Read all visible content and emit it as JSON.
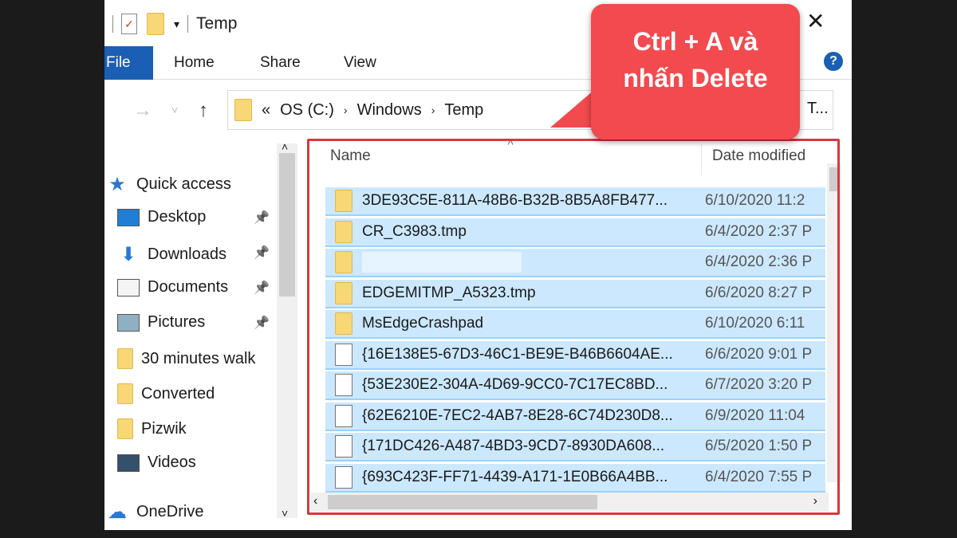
{
  "window": {
    "title": "Temp",
    "close_icon": "close-icon",
    "help_icon": "help-icon"
  },
  "ribbon": {
    "tabs": [
      "File",
      "Home",
      "Share",
      "View"
    ]
  },
  "address": {
    "prefix": "«",
    "segments": [
      "OS (C:)",
      "Windows",
      "Temp"
    ],
    "search_placeholder": "T..."
  },
  "sidebar": {
    "items": [
      {
        "label": "Quick access",
        "icon": "star-icon"
      },
      {
        "label": "Desktop",
        "icon": "desktop-icon",
        "pinned": true
      },
      {
        "label": "Downloads",
        "icon": "download-icon",
        "pinned": true
      },
      {
        "label": "Documents",
        "icon": "document-icon",
        "pinned": true
      },
      {
        "label": "Pictures",
        "icon": "pictures-icon",
        "pinned": true
      },
      {
        "label": "30 minutes walk",
        "icon": "folder-icon"
      },
      {
        "label": "Converted",
        "icon": "folder-icon"
      },
      {
        "label": "Pizwik",
        "icon": "folder-icon"
      },
      {
        "label": "Videos",
        "icon": "videos-icon"
      },
      {
        "label": "OneDrive",
        "icon": "cloud-icon"
      }
    ]
  },
  "columns": {
    "name": "Name",
    "date": "Date modified"
  },
  "files": [
    {
      "name": "3DE93C5E-811A-48B6-B32B-8B5A8FB477...",
      "date": "6/10/2020 11:2",
      "type": "folder"
    },
    {
      "name": "CR_C3983.tmp",
      "date": "6/4/2020 2:37 P",
      "type": "folder"
    },
    {
      "name": "",
      "date": "6/4/2020 2:36 P",
      "type": "folder"
    },
    {
      "name": "EDGEMITMP_A5323.tmp",
      "date": "6/6/2020 8:27 P",
      "type": "folder"
    },
    {
      "name": "MsEdgeCrashpad",
      "date": "6/10/2020 6:11",
      "type": "folder"
    },
    {
      "name": "{16E138E5-67D3-46C1-BE9E-B46B6604AE...",
      "date": "6/6/2020 9:01 P",
      "type": "file"
    },
    {
      "name": "{53E230E2-304A-4D69-9CC0-7C17EC8BD...",
      "date": "6/7/2020 3:20 P",
      "type": "file"
    },
    {
      "name": "{62E6210E-7EC2-4AB7-8E28-6C74D230D8...",
      "date": "6/9/2020 11:04",
      "type": "file"
    },
    {
      "name": "{171DC426-A487-4BD3-9CD7-8930DA608...",
      "date": "6/5/2020 1:50 P",
      "type": "file"
    },
    {
      "name": "{693C423F-FF71-4439-A171-1E0B66A4BB...",
      "date": "6/4/2020 7:55 P",
      "type": "file"
    }
  ],
  "callout": {
    "line1": "Ctrl + A và",
    "line2": "nhấn Delete",
    "color": "#f24a4f"
  },
  "highlight_color": "#d9373d"
}
